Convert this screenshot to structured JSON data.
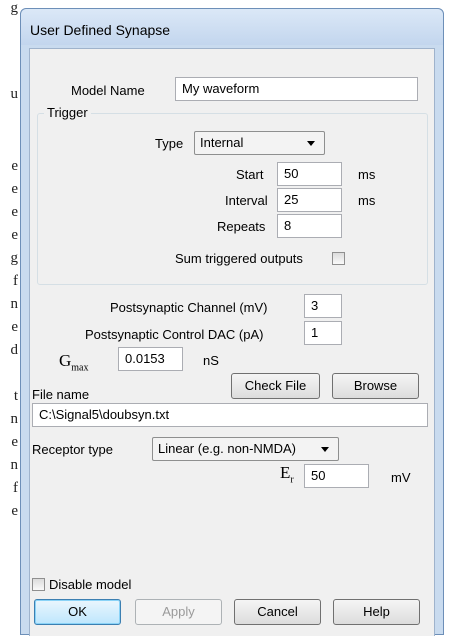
{
  "background_glyphs": [
    "g",
    "u",
    "e",
    "e",
    "e",
    "e",
    "g",
    "f",
    "n",
    "e",
    "d",
    "t",
    "n",
    "e",
    "n",
    "f",
    "e"
  ],
  "window": {
    "title": "User Defined Synapse"
  },
  "model": {
    "label": "Model Name",
    "value": "My waveform"
  },
  "trigger": {
    "group_label": "Trigger",
    "type_label": "Type",
    "type_value": "Internal",
    "start_label": "Start",
    "start_value": "50",
    "start_unit": "ms",
    "interval_label": "Interval",
    "interval_value": "25",
    "interval_unit": "ms",
    "repeats_label": "Repeats",
    "repeats_value": "8",
    "sum_label": "Sum triggered outputs",
    "sum_checked": false
  },
  "postsynaptic": {
    "channel_label": "Postsynaptic Channel (mV)",
    "channel_value": "3",
    "dac_label": "Postsynaptic Control DAC (pA)",
    "dac_value": "1"
  },
  "gmax": {
    "symbol": "G",
    "subscript": "max",
    "value": "0.0153",
    "unit": "nS"
  },
  "file": {
    "label": "File name",
    "check_button": "Check File",
    "browse_button": "Browse",
    "path": "C:\\Signal5\\doubsyn.txt"
  },
  "receptor": {
    "label": "Receptor type",
    "value": "Linear (e.g. non-NMDA)"
  },
  "er": {
    "symbol": "E",
    "subscript": "r",
    "value": "50",
    "unit": "mV"
  },
  "disable": {
    "label": "Disable model",
    "checked": false
  },
  "buttons": {
    "ok": "OK",
    "apply": "Apply",
    "cancel": "Cancel",
    "help": "Help"
  },
  "colors": {
    "frame": "#c9dbef",
    "client": "#f0f0f0",
    "default_button": "#bee6fd"
  }
}
